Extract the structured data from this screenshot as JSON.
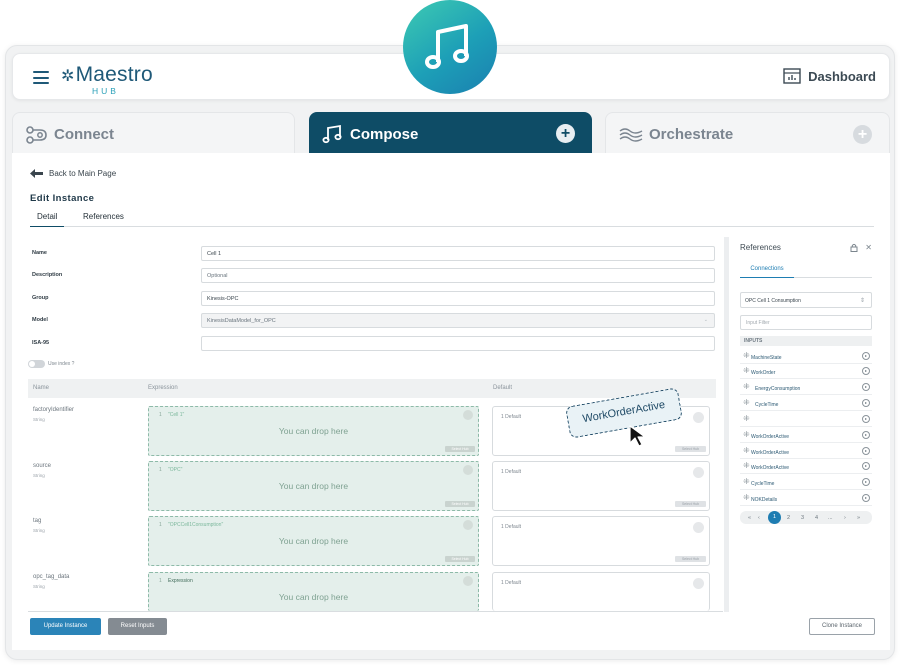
{
  "app": {
    "logo_main": "Maestro",
    "logo_sub": "HUB",
    "dashboard_label": "Dashboard"
  },
  "tabs": [
    {
      "label": "Connect",
      "icon": "connect-icon"
    },
    {
      "label": "Compose",
      "icon": "music-note-icon",
      "plus": "+"
    },
    {
      "label": "Orchestrate",
      "icon": "waves-icon",
      "plus": "+"
    }
  ],
  "page": {
    "back_label": "Back to Main Page",
    "title": "Edit Instance",
    "subtabs": [
      "Detail",
      "References"
    ]
  },
  "form": {
    "name_label": "Name",
    "name_value": "Cell 1",
    "description_label": "Description",
    "description_placeholder": "Optional",
    "group_label": "Group",
    "group_value": "Kinesis-OPC",
    "model_label": "Model",
    "model_value": "KinesisDataModel_for_OPC",
    "isa_label": "ISA-95",
    "isa_value": "",
    "use_index_label": "Use index ?"
  },
  "table": {
    "headers": {
      "name": "Name",
      "expression": "Expression",
      "default": "Default"
    },
    "drop_text": "You can drop here",
    "default_text": "Default",
    "select_text": "Select Hub",
    "rows": [
      {
        "name": "factoryIdentifier",
        "type": "String",
        "line": "1",
        "code": "\"Cell 1\"",
        "def_line": "1"
      },
      {
        "name": "source",
        "type": "String",
        "line": "1",
        "code": "\"OPC\"",
        "def_line": "1"
      },
      {
        "name": "tag",
        "type": "String",
        "line": "1",
        "code": "\"OPCCell1Consumption\"",
        "def_line": "1"
      },
      {
        "name": "opc_tag_data",
        "type": "String",
        "line": "1",
        "code": "Expression",
        "def_line": "1"
      }
    ]
  },
  "drag_chip": "WorkOrderActive",
  "references": {
    "title": "References",
    "tab": "Connections",
    "selected_connection": "OPC Cell 1 Consumption",
    "filter_placeholder": "Input Filter",
    "inputs_header": "INPUTS",
    "inputs": [
      "MachineState",
      "WorkOrder",
      "EnergyConsumption",
      "CycleTime",
      "",
      "WorkOrderActive",
      "WorkOrderActive",
      "WorkOrderActive",
      "CycleTime",
      "NOKDetails"
    ],
    "pager": {
      "prev": "‹",
      "first": "«",
      "pages": [
        "1",
        "2",
        "3",
        "4"
      ],
      "ellipsis": "...",
      "next": "›",
      "last": "»"
    }
  },
  "actions": {
    "update": "Update Instance",
    "reset": "Reset Inputs",
    "clone": "Clone Instance"
  },
  "colors": {
    "primary": "#0e4c66",
    "accent": "#1e7db2",
    "drop_zone": "#e4efeb",
    "badge_gradient_start": "#3ecbb2",
    "badge_gradient_end": "#1a7fb0"
  }
}
